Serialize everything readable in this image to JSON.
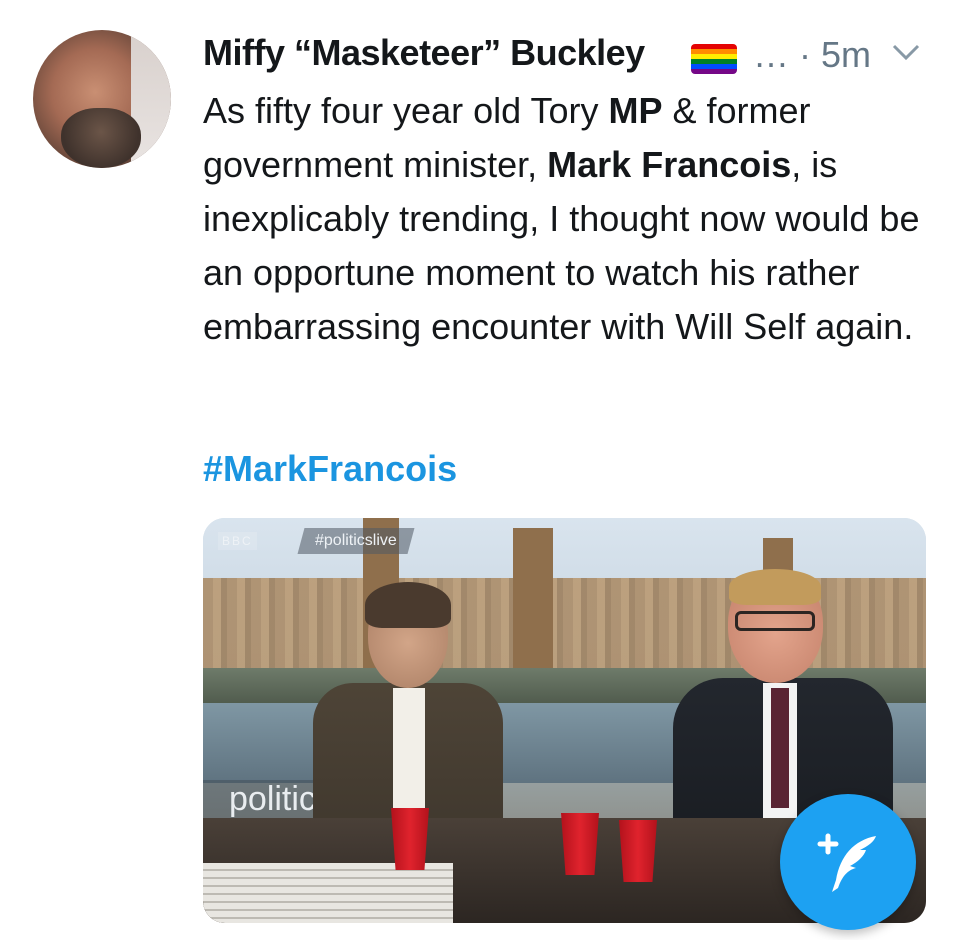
{
  "tweet": {
    "display_name": "Miffy “Masketeer” Buckley",
    "name_emoji": "rainbow-flag",
    "ellipsis": "…",
    "separator": "·",
    "time_ago": "5m",
    "body_parts": [
      {
        "text": "As fifty four year old Tory ",
        "bold": false
      },
      {
        "text": "MP",
        "bold": true
      },
      {
        "text": " & former government minister, ",
        "bold": false
      },
      {
        "text": "Mark Francois",
        "bold": true
      },
      {
        "text": ", is inexplicably trending, I thought now would be an opportune moment to watch his rather embarrassing encounter with Will Self again.",
        "bold": false
      }
    ],
    "hashtag": "#MarkFrancois"
  },
  "media": {
    "broadcaster_logo": "BBC",
    "show_tag": "#politicslive",
    "lower_brand": "politic"
  },
  "compose_fab": {
    "icon": "compose-feather-plus-icon",
    "color": "#1da1f2"
  },
  "colors": {
    "text": "#14171a",
    "secondary": "#657786",
    "link": "#1b95e0"
  }
}
